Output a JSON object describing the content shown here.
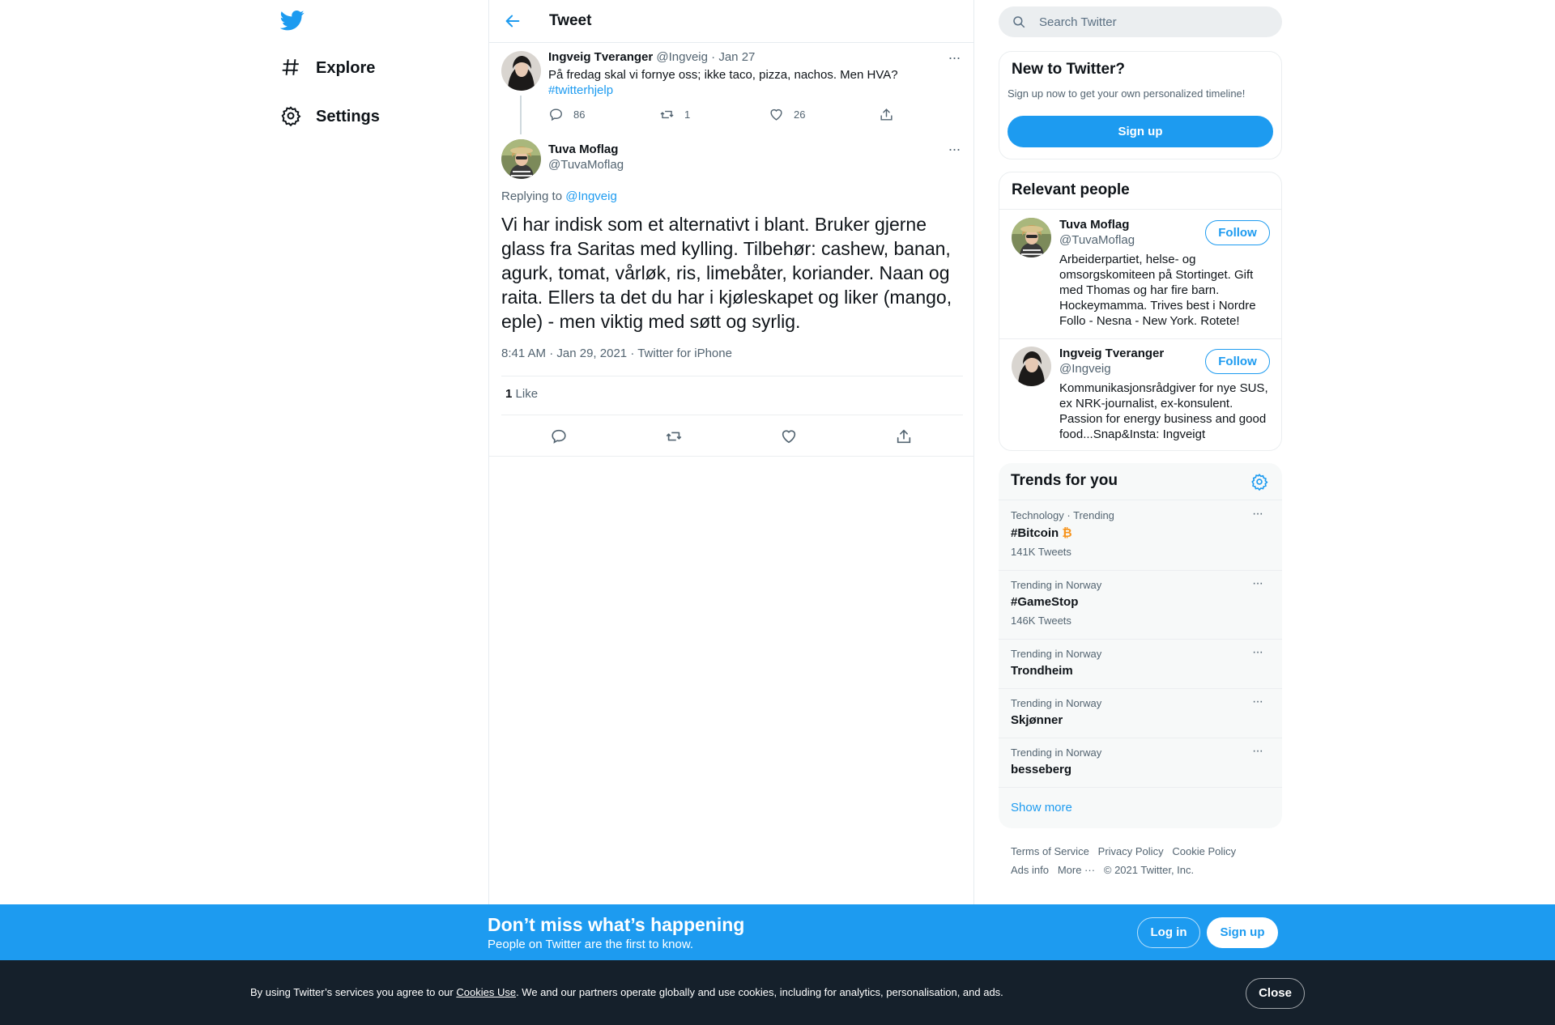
{
  "colors": {
    "accent": "#1d9bf0",
    "text": "#0f1419",
    "muted": "#536471",
    "bitcoin": "#f7931a",
    "cookie_bar": "#15202b"
  },
  "nav": {
    "items": [
      {
        "label": "Explore",
        "icon": "hashtag-icon"
      },
      {
        "label": "Settings",
        "icon": "gear-icon"
      }
    ]
  },
  "header": {
    "title": "Tweet"
  },
  "parent_tweet": {
    "name": "Ingveig Tveranger",
    "handle": "@Ingveig",
    "separator": "·",
    "date": "Jan 27",
    "text": "På fredag skal vi fornye oss; ikke taco, pizza, nachos. Men HVA?",
    "hashtag": "#twitterhjelp",
    "replies": "86",
    "retweets": "1",
    "likes": "26"
  },
  "main_tweet": {
    "name": "Tuva Moflag",
    "handle": "@TuvaMoflag",
    "replying_to_label": "Replying to",
    "replying_to_handle": "@Ingveig",
    "text": "Vi har indisk som et alternativt i blant. Bruker gjerne glass fra Saritas med kylling. Tilbehør: cashew, banan, agurk, tomat, vårløk, ris, limebåter, koriander. Naan og raita. Ellers ta det du har i kjøleskapet og liker (mango, eple) - men viktig med søtt og syrlig.",
    "time": "8:41 AM",
    "date": "Jan 29, 2021",
    "source": "Twitter for iPhone",
    "separator": "·",
    "like_count": "1",
    "like_label": "Like"
  },
  "search": {
    "placeholder": "Search Twitter"
  },
  "new_to_twitter": {
    "title": "New to Twitter?",
    "subtitle": "Sign up now to get your own personalized timeline!",
    "button": "Sign up"
  },
  "relevant_people": {
    "title": "Relevant people",
    "people": [
      {
        "name": "Tuva Moflag",
        "handle": "@TuvaMoflag",
        "bio": "Arbeiderpartiet, helse- og omsorgskomiteen på Stortinget. Gift med Thomas og har fire barn. Hockeymamma. Trives best i Nordre Follo - Nesna - New York. Rotete!",
        "button": "Follow"
      },
      {
        "name": "Ingveig Tveranger",
        "handle": "@Ingveig",
        "bio": "Kommunikasjonsrådgiver for nye SUS, ex NRK-journalist, ex-konsulent. Passion for energy business and good food...Snap&Insta: Ingveigt",
        "button": "Follow"
      }
    ]
  },
  "trends": {
    "title": "Trends for you",
    "items": [
      {
        "meta": "Technology · Trending",
        "name": "#Bitcoin",
        "emoji": "₿",
        "count": "141K Tweets"
      },
      {
        "meta": "Trending in Norway",
        "name": "#GameStop",
        "count": "146K Tweets"
      },
      {
        "meta": "Trending in Norway",
        "name": "Trondheim"
      },
      {
        "meta": "Trending in Norway",
        "name": "Skjønner"
      },
      {
        "meta": "Trending in Norway",
        "name": "besseberg"
      }
    ],
    "show_more": "Show more"
  },
  "footer": {
    "links": [
      "Terms of Service",
      "Privacy Policy",
      "Cookie Policy",
      "Ads info",
      "More ···"
    ],
    "copyright": "© 2021 Twitter, Inc."
  },
  "bottom_bar": {
    "heading": "Don’t miss what’s happening",
    "subheading": "People on Twitter are the first to know.",
    "login": "Log in",
    "signup": "Sign up"
  },
  "cookie_bar": {
    "text_before": "By using Twitter’s services you agree to our ",
    "link": "Cookies Use",
    "text_after": ". We and our partners operate globally and use cookies, including for analytics, personalisation, and ads.",
    "close": "Close"
  }
}
